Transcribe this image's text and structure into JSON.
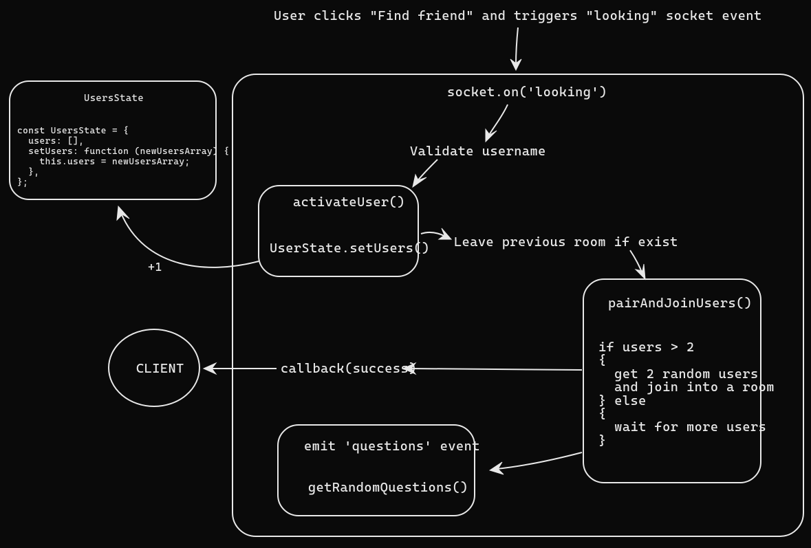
{
  "title": "User clicks \"Find friend\" and triggers \"looking\" socket event",
  "usersState": {
    "header": "UsersState",
    "code": "const UsersState = {\n  users: [],\n  setUsers: function (newUsersArray) {\n    this.users = newUsersArray;\n  },\n};"
  },
  "socketOn": "socket.on('looking')",
  "validate": "Validate username",
  "activateUser": {
    "line1": "activateUser()",
    "line2": "UserState.setUsers()"
  },
  "plusOne": "+1",
  "leavePrev": "Leave previous room if exist",
  "pairJoin": {
    "header": "pairAndJoinUsers()",
    "body": "if users > 2\n{\n  get 2 random users\n  and join into a room\n} else\n{\n  wait for more users\n}"
  },
  "callback": "callback(success)",
  "client": "CLIENT",
  "emitQuestions": {
    "line1": "emit 'questions' event",
    "line2": "getRandomQuestions()"
  }
}
